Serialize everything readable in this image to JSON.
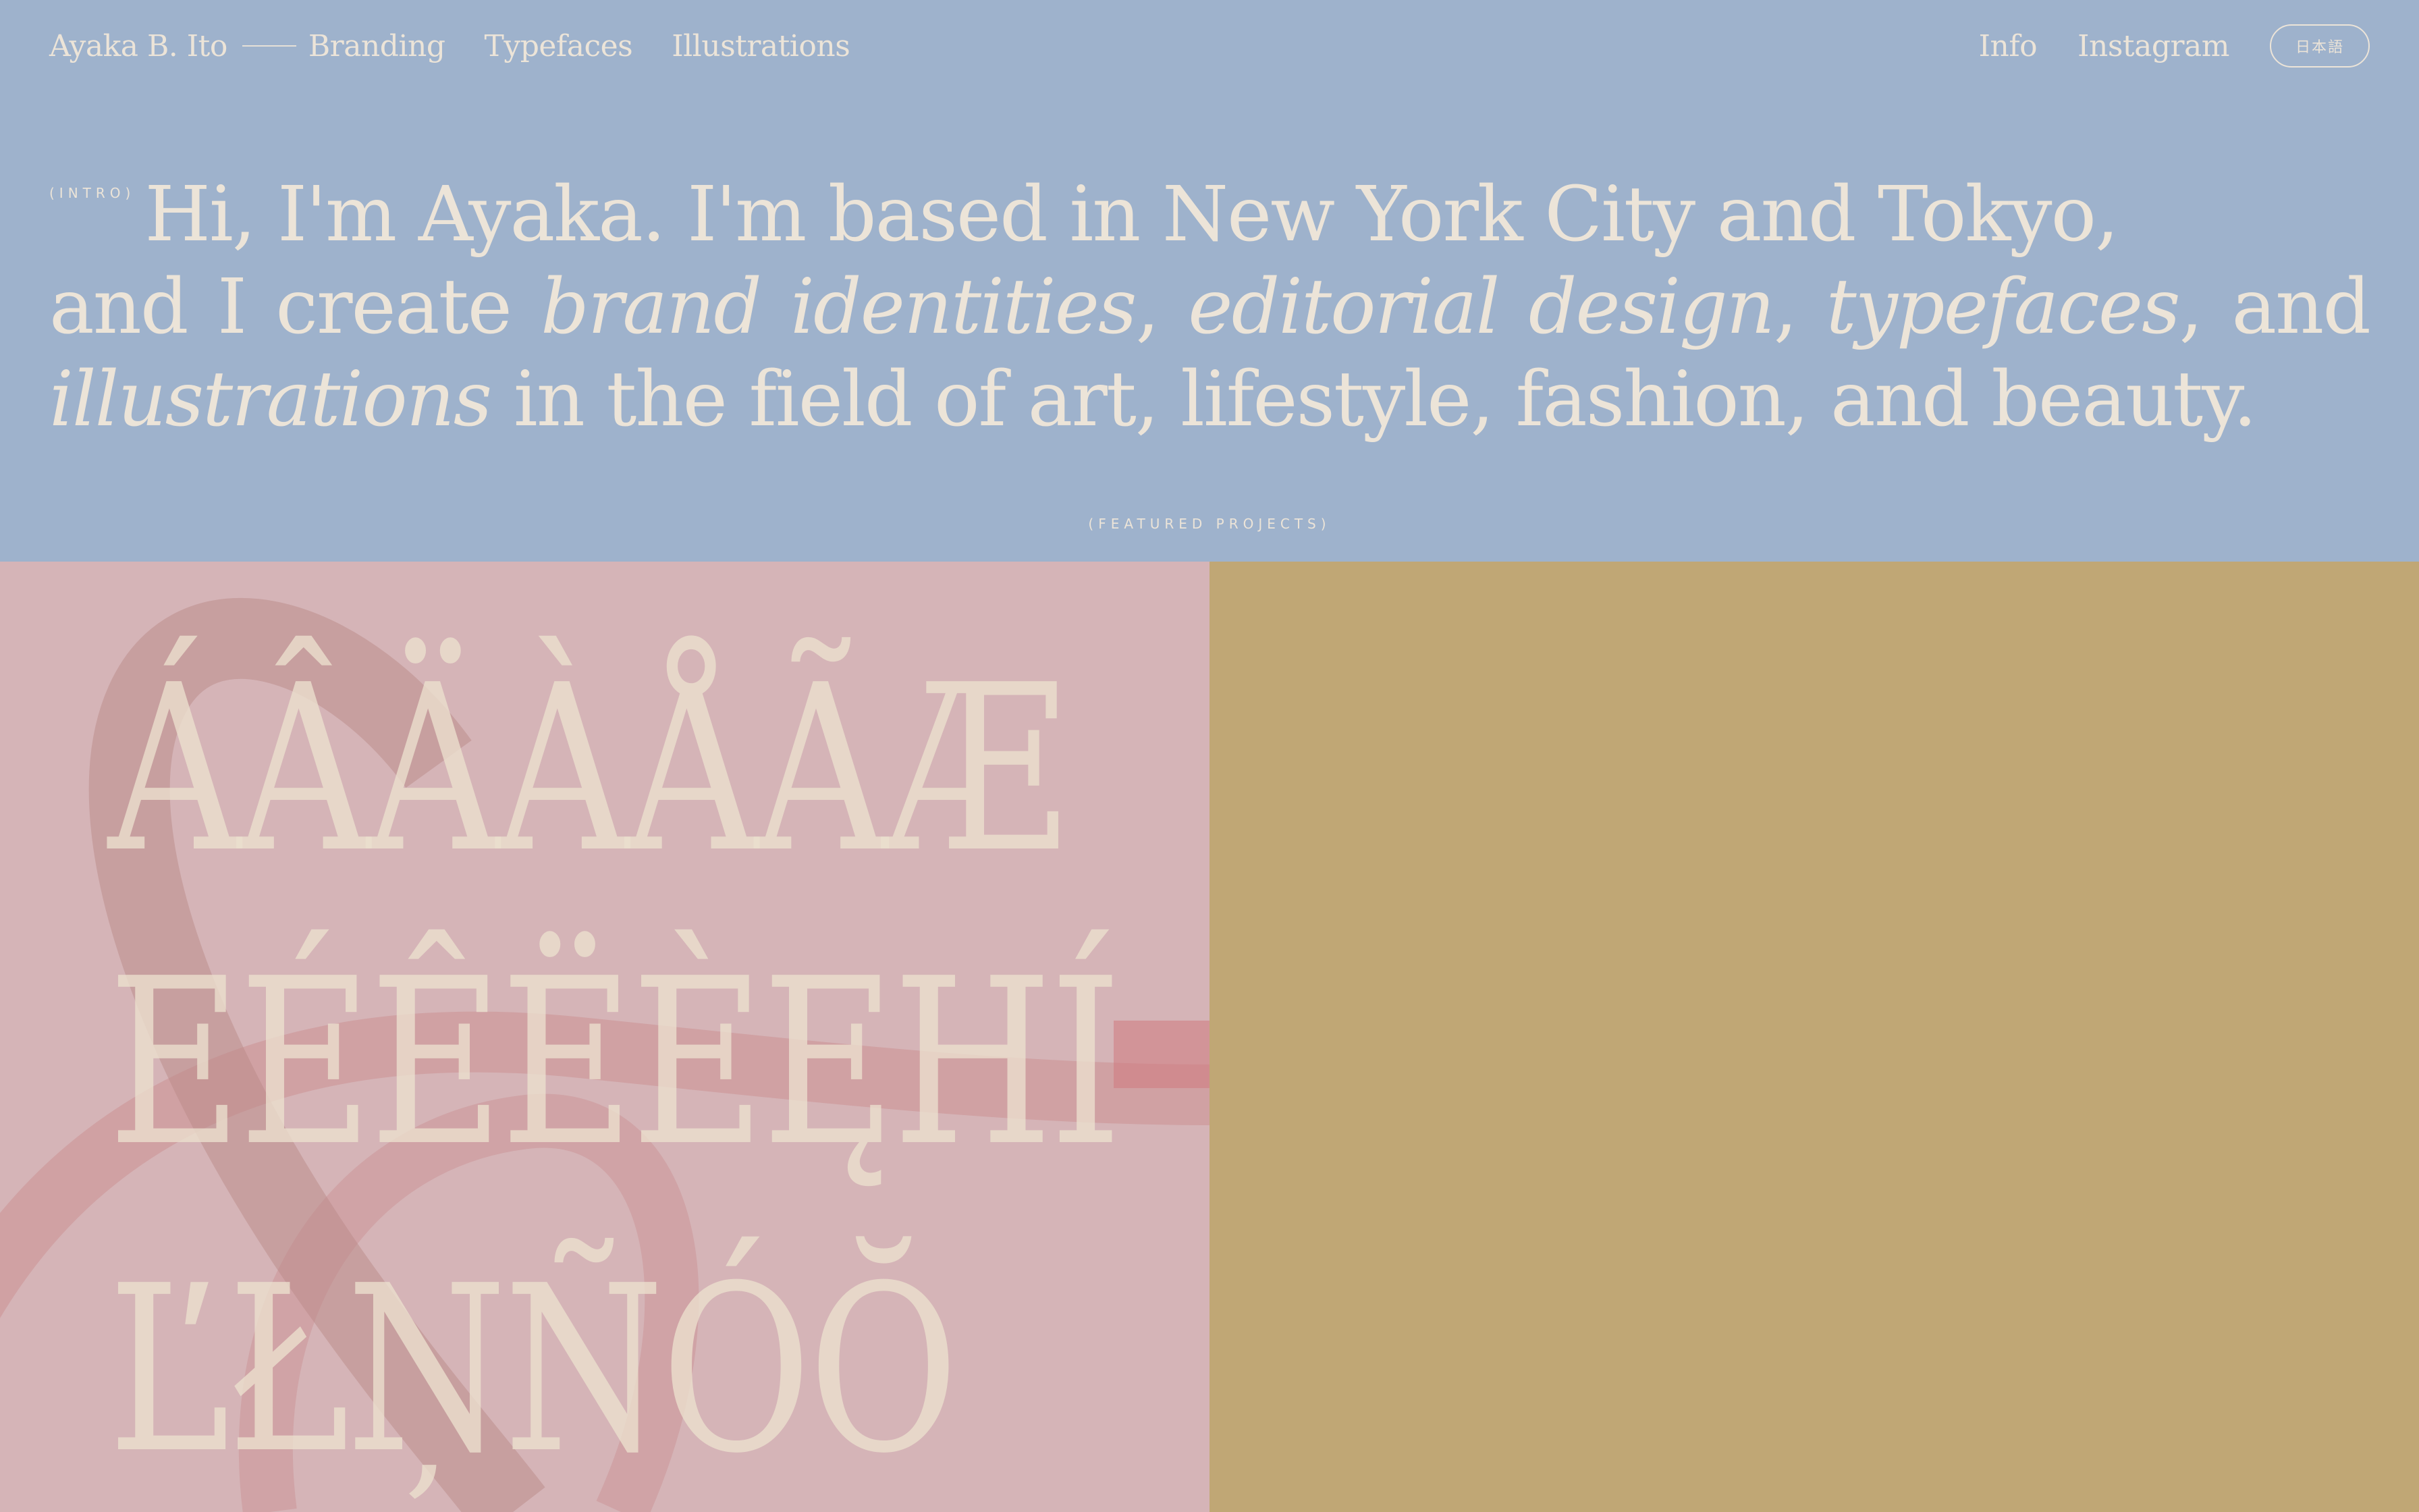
{
  "nav": {
    "brand": "Ayaka B. Ito",
    "links_left": [
      "Branding",
      "Typefaces",
      "Illustrations"
    ],
    "links_right": [
      "Info",
      "Instagram"
    ],
    "language_button": "日本語"
  },
  "intro": {
    "label": "(INTRO)",
    "line1": "Hi, I'm Ayaka. I'm based in New York City and Tokyo,",
    "part_and": "and I create ",
    "em1": "brand identities",
    "sep1": ", ",
    "em2": "editorial design",
    "sep2": ", ",
    "em3": "typefaces",
    "sep3": ", and ",
    "em4": "illustrations",
    "tail": " in the field of art, lifestyle, fashion, and beauty."
  },
  "featured": {
    "label": "(FEATURED PROJECTS)",
    "glyph_rows": [
      "ÁÂÄÀÅÃÆ",
      "EÉÊËÈĘHÍ",
      "ĽŁŅÑÓŎ"
    ]
  },
  "colors": {
    "header_bg": "#9eb2cc",
    "text": "#ece4d8",
    "panel_left_bg": "#d5b4b7",
    "panel_right_bg": "#c0a775",
    "ribbon": "#c98a8c"
  }
}
